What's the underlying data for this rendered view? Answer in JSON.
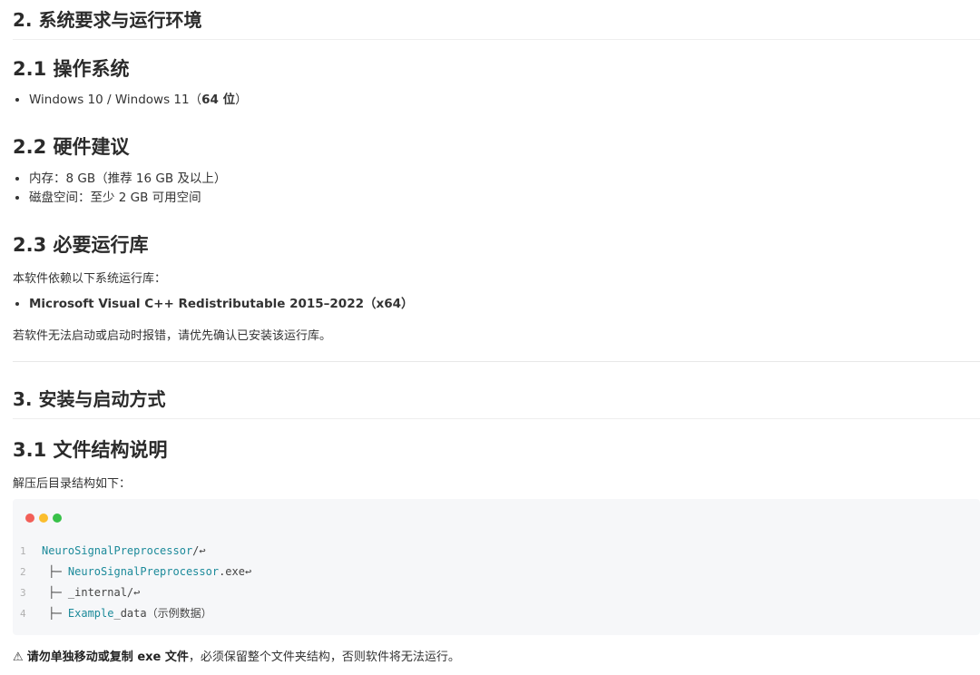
{
  "sec2": {
    "title": "2. 系统要求与运行环境"
  },
  "os": {
    "title": "2.1 操作系统",
    "item_prefix": "Windows 10 / Windows 11（",
    "item_bold": "64 位",
    "item_suffix": "）"
  },
  "hardware": {
    "title": "2.2 硬件建议",
    "items": [
      "内存：8 GB（推荐 16 GB 及以上）",
      "磁盘空间：至少 2 GB 可用空间"
    ]
  },
  "runtime": {
    "title": "2.3 必要运行库",
    "intro": "本软件依赖以下系统运行库：",
    "item": "Microsoft Visual C++ Redistributable 2015–2022（x64）",
    "note": "若软件无法启动或启动时报错，请优先确认已安装该运行库。"
  },
  "sec3": {
    "title": "3. 安装与启动方式"
  },
  "structure": {
    "title": "3.1 文件结构说明",
    "intro": "解压后目录结构如下：",
    "dots": [
      "#f25f58",
      "#fbbe2e",
      "#38c149"
    ],
    "lines": [
      {
        "num": "1",
        "prefix": "",
        "ident": "NeuroSignalPreprocessor",
        "rest": "/↩"
      },
      {
        "num": "2",
        "prefix": " ├─ ",
        "ident": "NeuroSignalPreprocessor",
        "rest": ".exe↩"
      },
      {
        "num": "3",
        "prefix": " ├─ ",
        "ident": "",
        "rest": "_internal/↩"
      },
      {
        "num": "4",
        "prefix": " ├─ ",
        "ident": "Example",
        "rest": "_data（示例数据）"
      }
    ]
  },
  "warning": {
    "icon": "⚠",
    "bold": "请勿单独移动或复制 exe 文件",
    "rest": "，必须保留整个文件夹结构，否则软件将无法运行。"
  }
}
